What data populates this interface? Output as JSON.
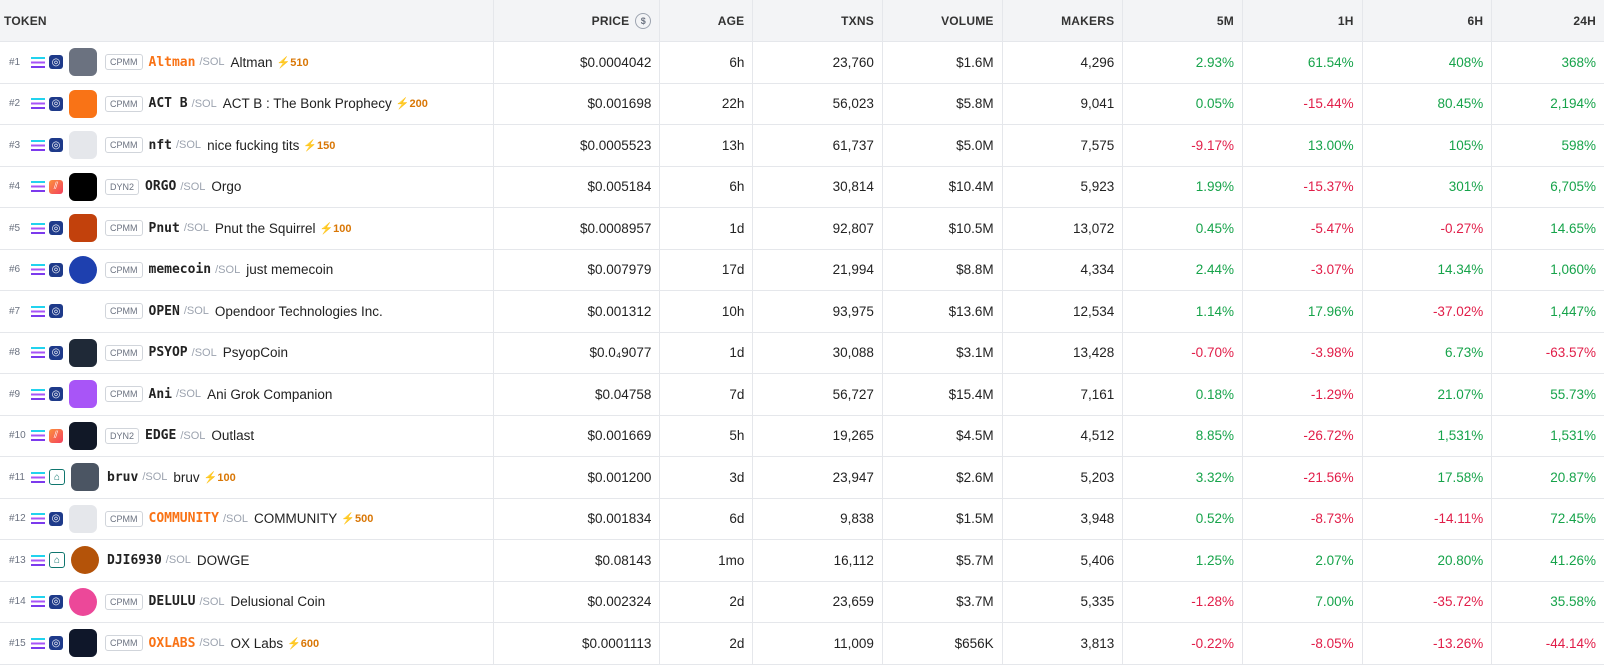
{
  "header": {
    "token": "TOKEN",
    "price": "PRICE",
    "age": "AGE",
    "txns": "TXNS",
    "volume": "VOLUME",
    "makers": "MAKERS",
    "m5": "5M",
    "h1": "1H",
    "h6": "6H",
    "h24": "24H"
  },
  "quote_label": "/SOL",
  "rows": [
    {
      "rank": "#1",
      "tag": "CPMM",
      "symbol": "Altman",
      "name": "Altman",
      "boost": "⚡510",
      "price": "$0.0004042",
      "age": "6h",
      "txns": "23,760",
      "volume": "$1.6M",
      "makers": "4,296",
      "m5": "2.93%",
      "h1": "61.54%",
      "h6": "408%",
      "h24": "368%"
    },
    {
      "rank": "#2",
      "tag": "CPMM",
      "symbol": "ACT B",
      "name": "ACT B : The Bonk Prophecy",
      "boost": "⚡200",
      "price": "$0.001698",
      "age": "22h",
      "txns": "56,023",
      "volume": "$5.8M",
      "makers": "9,041",
      "m5": "0.05%",
      "h1": "-15.44%",
      "h6": "80.45%",
      "h24": "2,194%"
    },
    {
      "rank": "#3",
      "tag": "CPMM",
      "symbol": "nft",
      "name": "nice fucking tits",
      "boost": "⚡150",
      "price": "$0.0005523",
      "age": "13h",
      "txns": "61,737",
      "volume": "$5.0M",
      "makers": "7,575",
      "m5": "-9.17%",
      "h1": "13.00%",
      "h6": "105%",
      "h24": "598%"
    },
    {
      "rank": "#4",
      "tag": "DYN2",
      "symbol": "ORGO",
      "name": "Orgo",
      "boost": "",
      "price": "$0.005184",
      "age": "6h",
      "txns": "30,814",
      "volume": "$10.4M",
      "makers": "5,923",
      "m5": "1.99%",
      "h1": "-15.37%",
      "h6": "301%",
      "h24": "6,705%"
    },
    {
      "rank": "#5",
      "tag": "CPMM",
      "symbol": "Pnut",
      "name": "Pnut the Squirrel",
      "boost": "⚡100",
      "price": "$0.0008957",
      "age": "1d",
      "txns": "92,807",
      "volume": "$10.5M",
      "makers": "13,072",
      "m5": "0.45%",
      "h1": "-5.47%",
      "h6": "-0.27%",
      "h24": "14.65%"
    },
    {
      "rank": "#6",
      "tag": "CPMM",
      "symbol": "memecoin",
      "name": "just memecoin",
      "boost": "",
      "price": "$0.007979",
      "age": "17d",
      "txns": "21,994",
      "volume": "$8.8M",
      "makers": "4,334",
      "m5": "2.44%",
      "h1": "-3.07%",
      "h6": "14.34%",
      "h24": "1,060%"
    },
    {
      "rank": "#7",
      "tag": "CPMM",
      "symbol": "OPEN",
      "name": "Opendoor Technologies Inc.",
      "boost": "",
      "price": "$0.001312",
      "age": "10h",
      "txns": "93,975",
      "volume": "$13.6M",
      "makers": "12,534",
      "m5": "1.14%",
      "h1": "17.96%",
      "h6": "-37.02%",
      "h24": "1,447%"
    },
    {
      "rank": "#8",
      "tag": "CPMM",
      "symbol": "PSYOP",
      "name": "PsyopCoin",
      "boost": "",
      "price": "$0.0₄9077",
      "age": "1d",
      "txns": "30,088",
      "volume": "$3.1M",
      "makers": "13,428",
      "m5": "-0.70%",
      "h1": "-3.98%",
      "h6": "6.73%",
      "h24": "-63.57%"
    },
    {
      "rank": "#9",
      "tag": "CPMM",
      "symbol": "Ani",
      "name": "Ani Grok Companion",
      "boost": "",
      "price": "$0.04758",
      "age": "7d",
      "txns": "56,727",
      "volume": "$15.4M",
      "makers": "7,161",
      "m5": "0.18%",
      "h1": "-1.29%",
      "h6": "21.07%",
      "h24": "55.73%"
    },
    {
      "rank": "#10",
      "tag": "DYN2",
      "symbol": "EDGE",
      "name": "Outlast",
      "boost": "",
      "price": "$0.001669",
      "age": "5h",
      "txns": "19,265",
      "volume": "$4.5M",
      "makers": "4,512",
      "m5": "8.85%",
      "h1": "-26.72%",
      "h6": "1,531%",
      "h24": "1,531%"
    },
    {
      "rank": "#11",
      "tag": "",
      "symbol": "bruv",
      "name": "bruv",
      "boost": "⚡100",
      "price": "$0.001200",
      "age": "3d",
      "txns": "23,947",
      "volume": "$2.6M",
      "makers": "5,203",
      "m5": "3.32%",
      "h1": "-21.56%",
      "h6": "17.58%",
      "h24": "20.87%"
    },
    {
      "rank": "#12",
      "tag": "CPMM",
      "symbol": "COMMUNITY",
      "name": "COMMUNITY",
      "boost": "⚡500",
      "price": "$0.001834",
      "age": "6d",
      "txns": "9,838",
      "volume": "$1.5M",
      "makers": "3,948",
      "m5": "0.52%",
      "h1": "-8.73%",
      "h6": "-14.11%",
      "h24": "72.45%"
    },
    {
      "rank": "#13",
      "tag": "",
      "symbol": "DJI6930",
      "name": "DOWGE",
      "boost": "",
      "price": "$0.08143",
      "age": "1mo",
      "txns": "16,112",
      "volume": "$5.7M",
      "makers": "5,406",
      "m5": "1.25%",
      "h1": "2.07%",
      "h6": "20.80%",
      "h24": "41.26%"
    },
    {
      "rank": "#14",
      "tag": "CPMM",
      "symbol": "DELULU",
      "name": "Delusional Coin",
      "boost": "",
      "price": "$0.002324",
      "age": "2d",
      "txns": "23,659",
      "volume": "$3.7M",
      "makers": "5,335",
      "m5": "-1.28%",
      "h1": "7.00%",
      "h6": "-35.72%",
      "h24": "35.58%"
    },
    {
      "rank": "#15",
      "tag": "CPMM",
      "symbol": "OXLABS",
      "name": "OX Labs",
      "boost": "⚡600",
      "price": "$0.0001113",
      "age": "2d",
      "txns": "11,009",
      "volume": "$656K",
      "makers": "3,813",
      "m5": "-0.22%",
      "h1": "-8.05%",
      "h6": "-13.26%",
      "h24": "-44.14%"
    }
  ],
  "avatar_colors": [
    "#6b7280",
    "#f97316",
    "#e5e7eb",
    "#000000",
    "#c2410c",
    "#1e40af",
    "#ffffff",
    "#1f2937",
    "#a855f7",
    "#111827",
    "#4b5563",
    "#e5e7eb",
    "#b45309",
    "#ec4899",
    "#0f172a"
  ],
  "dex_icons": [
    "dex-icon",
    "dex-icon",
    "dex-icon",
    "orange-dex-icon",
    "dex-icon",
    "dex-icon",
    "dex-icon",
    "dex-icon",
    "dex-icon",
    "orange-dex-icon",
    "green-dex-icon",
    "dex-icon",
    "green-dex-icon",
    "dex-icon",
    "dex-icon"
  ],
  "hot_symbols": [
    "Altman",
    "COMMUNITY",
    "OXLABS"
  ],
  "colors": {
    "positive": "#16a34a",
    "negative": "#e11d48",
    "header_bg": "#f3f4f6"
  }
}
